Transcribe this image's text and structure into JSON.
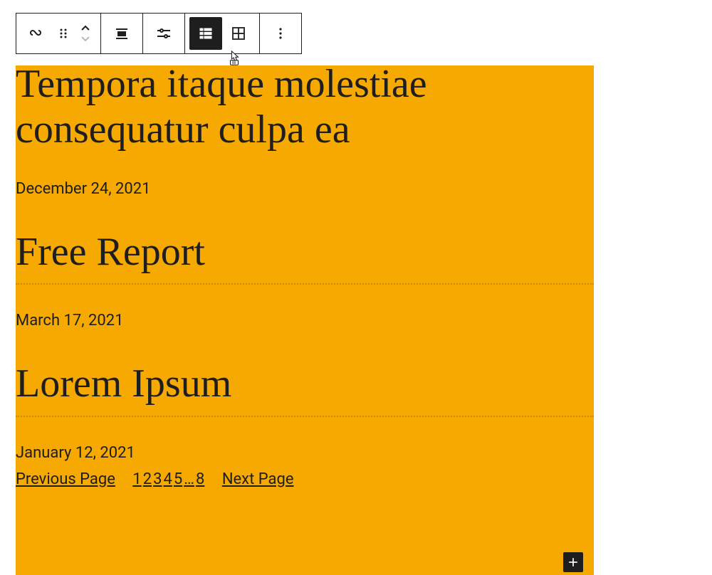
{
  "toolbar": {
    "items": [
      {
        "name": "query-loop-icon"
      },
      {
        "name": "drag-handle-icon"
      },
      {
        "name": "movers"
      },
      {
        "name": "align-icon"
      },
      {
        "name": "display-settings-icon"
      },
      {
        "name": "list-view-icon",
        "active": true
      },
      {
        "name": "grid-view-icon"
      },
      {
        "name": "more-options-icon"
      }
    ]
  },
  "posts": [
    {
      "title": "Tempora itaque molestiae consequatur culpa ea",
      "date": "December 24, 2021"
    },
    {
      "title": "Free Report",
      "date": "March 17, 2021"
    },
    {
      "title": "Lorem Ipsum",
      "date": "January 12, 2021"
    }
  ],
  "pagination": {
    "prev_label": "Previous Page",
    "next_label": "Next Page",
    "pages": [
      "1",
      "2",
      "3",
      "4",
      "5"
    ],
    "ellipsis": "…",
    "last": "8"
  },
  "colors": {
    "background": "#f6a900",
    "text": "#1e1e1e"
  }
}
